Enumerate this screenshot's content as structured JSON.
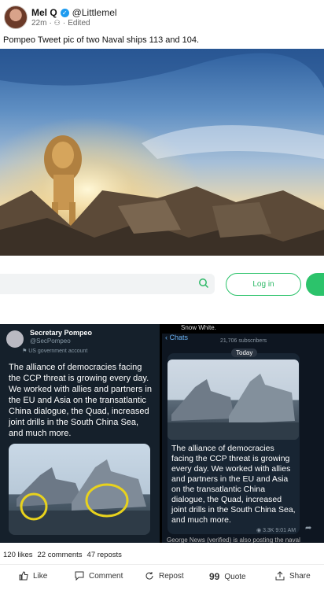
{
  "post": {
    "author_name": "Mel Q",
    "author_handle": "@Littlemel",
    "time": "22m",
    "edited": "Edited",
    "text": "Pompeo Tweet pic of two Naval ships 113 and 104."
  },
  "embed": {
    "login_label": "Log in"
  },
  "left_screenshot": {
    "title": "Secretary Pompeo",
    "handle": "@SecPompeo",
    "badge": "US government account",
    "body": "The alliance of democracies facing the CCP threat is growing every day. We worked with allies and partners in the EU and Asia on the transatlantic China dialogue, the Quad, increased joint drills in the South China Sea, and much more."
  },
  "right_screenshot": {
    "top_name": "Snow White.",
    "back_label": "Chats",
    "subscribers": "21,706 subscribers",
    "date_chip": "Today",
    "body": "The alliance of democracies facing the CCP threat is growing every day. We worked with allies and partners in the EU and Asia on the transatlantic China dialogue, the Quad, increased joint drills in the South China Sea, and much more.",
    "views_time": "3.3K 9:01 AM",
    "bottom_text": "George News (verified) is also posting the naval"
  },
  "stats": {
    "likes": "120 likes",
    "comments": "22 comments",
    "reposts": "47 reposts"
  },
  "actions": {
    "like": "Like",
    "comment": "Comment",
    "repost": "Repost",
    "quote": "Quote",
    "share": "Share"
  },
  "colors": {
    "verified": "#1d9bf0",
    "login_green": "#2cc36b",
    "highlight_yellow": "#e8d21d"
  }
}
